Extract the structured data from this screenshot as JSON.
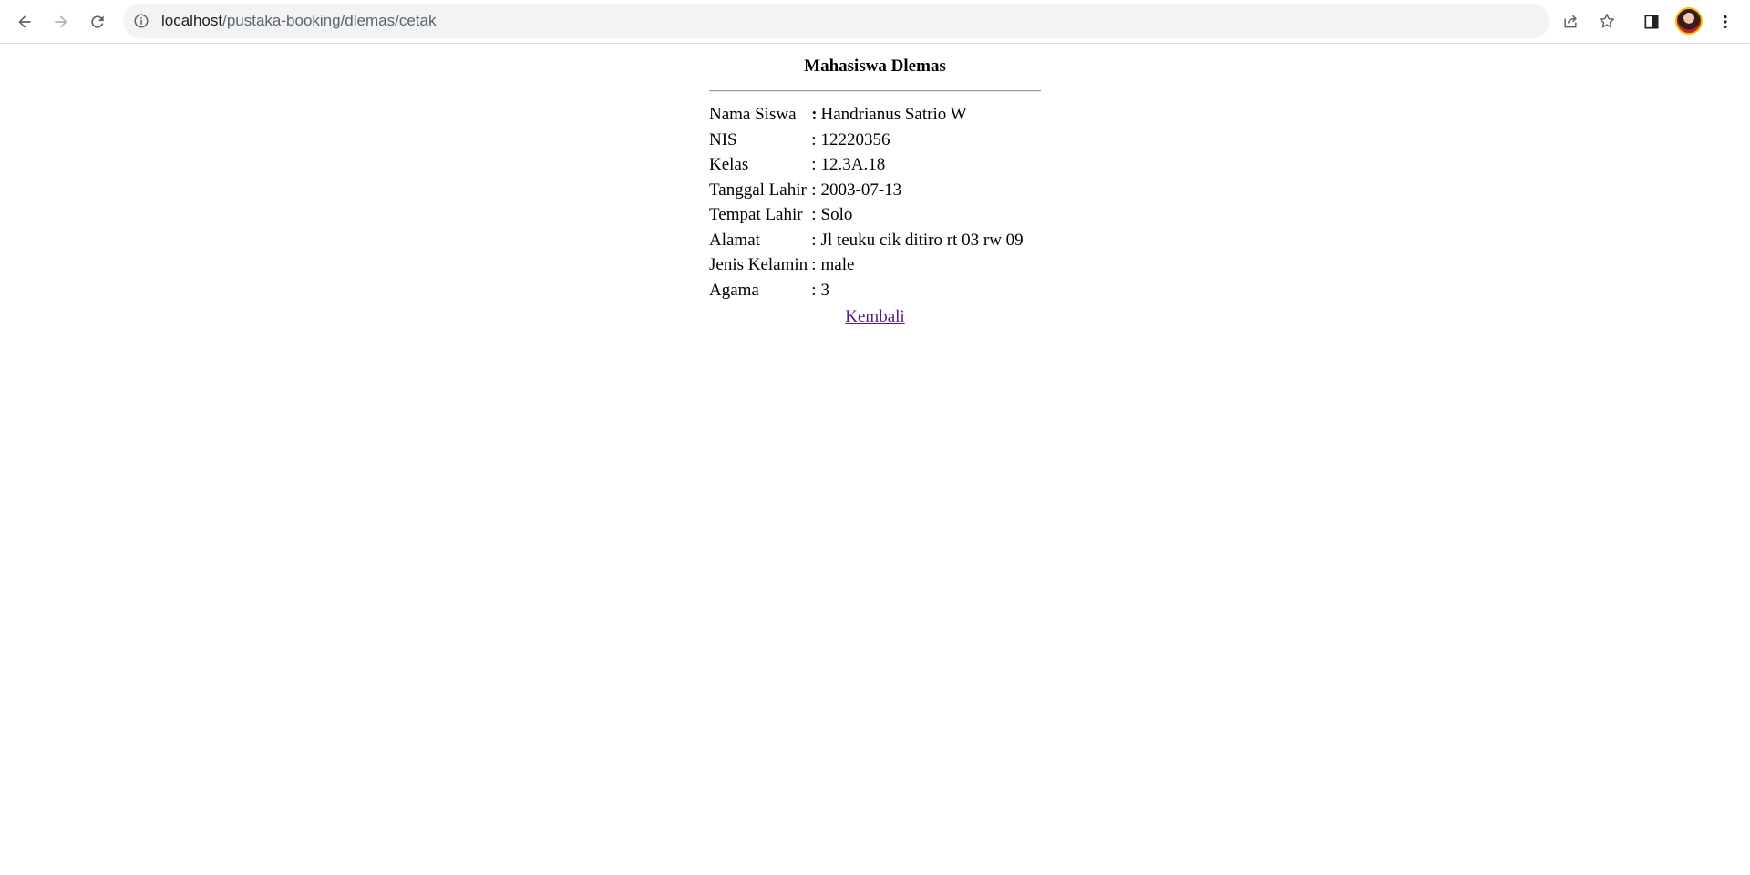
{
  "browser": {
    "url_host": "localhost",
    "url_path": "/pustaka-booking/dlemas/cetak",
    "icons": {
      "back": "arrow-left-icon",
      "forward": "arrow-right-icon",
      "reload": "reload-icon",
      "site_info": "info-icon",
      "share": "share-icon",
      "bookmark": "star-icon",
      "side_panel": "side-panel-icon",
      "menu": "kebab-menu-icon"
    }
  },
  "page": {
    "title": "Mahasiswa Dlemas",
    "rows": [
      {
        "label": "Nama Siswa",
        "sep": ":",
        "value": "Handrianus Satrio W"
      },
      {
        "label": "NIS",
        "sep": ":",
        "value": "12220356"
      },
      {
        "label": "Kelas",
        "sep": ":",
        "value": "12.3A.18"
      },
      {
        "label": "Tanggal Lahir",
        "sep": ":",
        "value": "2003-07-13"
      },
      {
        "label": "Tempat Lahir",
        "sep": ":",
        "value": "Solo"
      },
      {
        "label": "Alamat",
        "sep": ":",
        "value": "Jl teuku cik ditiro rt 03 rw 09"
      },
      {
        "label": "Jenis Kelamin",
        "sep": ":",
        "value": "male"
      },
      {
        "label": "Agama",
        "sep": ":",
        "value": "3"
      }
    ],
    "back_label": "Kembali",
    "link_color": "#551a8b"
  }
}
